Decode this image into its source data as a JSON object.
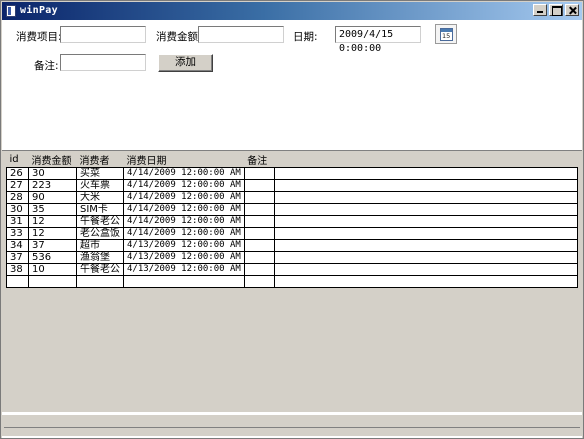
{
  "window": {
    "title": "winPay"
  },
  "form": {
    "item_label": "消费项目:",
    "item_value": "",
    "amount_label": "消费金额:",
    "amount_value": "",
    "date_label": "日期:",
    "date_value": "2009/4/15 0:00:00",
    "calendar_icon_text": "15",
    "note_label": "备注:",
    "note_value": "",
    "add_button": "添加"
  },
  "grid": {
    "columns": [
      "id",
      "消费金额",
      "消费者",
      "消费日期",
      "备注"
    ],
    "rows": [
      [
        "26",
        "30",
        "买菜",
        "4/14/2009 12:00:00 AM",
        ""
      ],
      [
        "27",
        "223",
        "火车票",
        "4/14/2009 12:00:00 AM",
        ""
      ],
      [
        "28",
        "90",
        "大米",
        "4/14/2009 12:00:00 AM",
        ""
      ],
      [
        "30",
        "35",
        "SIM卡",
        "4/14/2009 12:00:00 AM",
        ""
      ],
      [
        "31",
        "12",
        "午餐老公",
        "4/14/2009 12:00:00 AM",
        ""
      ],
      [
        "33",
        "12",
        "老公盒饭",
        "4/14/2009 12:00:00 AM",
        ""
      ],
      [
        "34",
        "37",
        "超市",
        "4/13/2009 12:00:00 AM",
        ""
      ],
      [
        "37",
        "536",
        "渔翁堡",
        "4/13/2009 12:00:00 AM",
        ""
      ],
      [
        "38",
        "10",
        "午餐老公",
        "4/13/2009 12:00:00 AM",
        ""
      ],
      [
        "",
        "",
        "",
        "",
        ""
      ]
    ]
  },
  "icons": {
    "app": "app-window-icon",
    "calendar": "calendar-icon",
    "minimize": "minimize-icon",
    "maximize": "maximize-icon",
    "close": "close-icon"
  }
}
